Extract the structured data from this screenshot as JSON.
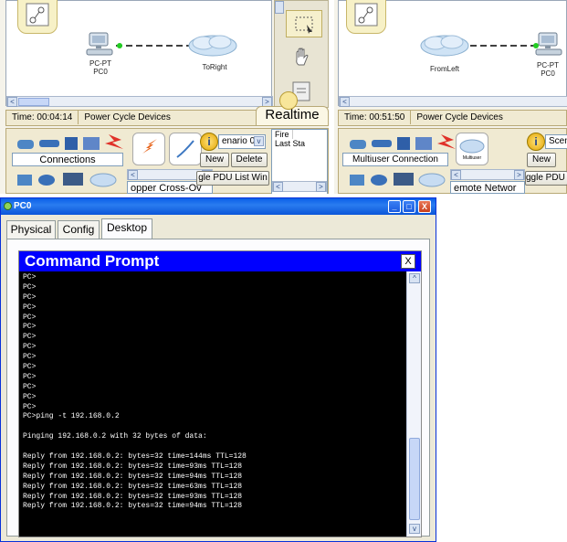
{
  "left_panel": {
    "device_left_label_top": "PC-PT",
    "device_left_label_bottom": "PC0",
    "cloud_label": "ToRight",
    "time_label": "Time: 00:04:14",
    "power_cycle": "Power Cycle Devices",
    "mode": "Realtime",
    "device_category": "Connections",
    "device_subtype": "opper Cross-Ov",
    "scenario_select": "enario 0",
    "new_btn": "New",
    "delete_btn": "Delete",
    "pdu_toggle": "gle PDU List Win",
    "pdu_col_fire": "Fire",
    "pdu_col_last": "Last Sta"
  },
  "right_panel": {
    "cloud_label": "FromLeft",
    "device_right_label_top": "PC-PT",
    "device_right_label_bottom": "PC0",
    "time_label": "Time: 00:51:50",
    "power_cycle": "Power Cycle Devices",
    "device_category": "Multiuser Connection",
    "device_subtype": "emote Networ",
    "multiuser_icon_text": "Multiuser",
    "scenario_select": "Scena",
    "new_btn": "New",
    "pdu_toggle": "ggle PDU L"
  },
  "window": {
    "title": "PC0",
    "tabs": [
      "Physical",
      "Config",
      "Desktop"
    ],
    "active_tab": "Desktop",
    "minimize_label": "_",
    "maximize_label": "□",
    "close_label": "X"
  },
  "command_prompt": {
    "title": "Command Prompt",
    "close_label": "X",
    "lines": [
      "PC>",
      "PC>",
      "PC>",
      "PC>",
      "PC>",
      "PC>",
      "PC>",
      "PC>",
      "PC>",
      "PC>",
      "PC>",
      "PC>",
      "PC>",
      "PC>",
      "PC>ping -t 192.168.0.2",
      "",
      "Pinging 192.168.0.2 with 32 bytes of data:",
      "",
      "Reply from 192.168.0.2: bytes=32 time=144ms TTL=128",
      "Reply from 192.168.0.2: bytes=32 time=93ms TTL=128",
      "Reply from 192.168.0.2: bytes=32 time=94ms TTL=128",
      "Reply from 192.168.0.2: bytes=32 time=63ms TTL=128",
      "Reply from 192.168.0.2: bytes=32 time=93ms TTL=128",
      "Reply from 192.168.0.2: bytes=32 time=94ms TTL=128"
    ]
  },
  "colors": {
    "xp_title_blue": "#0a5fe8",
    "cmd_title_blue": "#0000ff",
    "terminal_bg": "#000000",
    "link_green": "#22cc22"
  }
}
